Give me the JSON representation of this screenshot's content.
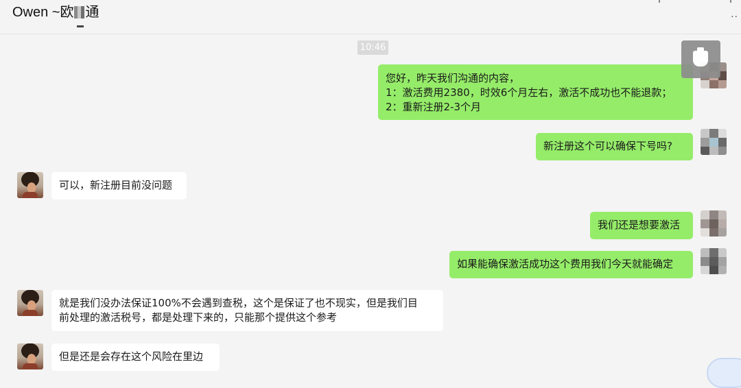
{
  "header": {
    "title_prefix": "Owen ~欧",
    "title_suffix": "通",
    "more_label": "··"
  },
  "timestamp": "10:46",
  "messages": [
    {
      "side": "out",
      "lines": [
        "您好，昨天我们沟通的内容，",
        "1：激活费用2380，时效6个月左右，激活不成功也不能退款；",
        "2：重新注册2-3个月"
      ]
    },
    {
      "side": "out",
      "lines": [
        "新注册这个可以确保下号吗?"
      ]
    },
    {
      "side": "in",
      "lines": [
        "可以，新注册目前没问题"
      ]
    },
    {
      "side": "out",
      "lines": [
        "我们还是想要激活"
      ]
    },
    {
      "side": "out",
      "lines": [
        "如果能确保激活成功这个费用我们今天就能确定"
      ]
    },
    {
      "side": "in",
      "lines": [
        "就是我们没办法保证100%不会遇到查税，这个是保证了也不现实，但是我们目",
        "前处理的激活税号，都是处理下来的，只能那个提供这个参考"
      ]
    },
    {
      "side": "in",
      "lines": [
        "但是还是会存在这个风险在里边"
      ]
    }
  ],
  "colors": {
    "background": "#f4f4f4",
    "outgoing_bubble": "#95ec69",
    "incoming_bubble": "#ffffff",
    "timestamp_bg": "#dadada"
  },
  "icons": {
    "popup": "cup-icon",
    "more": "more-dots-icon"
  }
}
